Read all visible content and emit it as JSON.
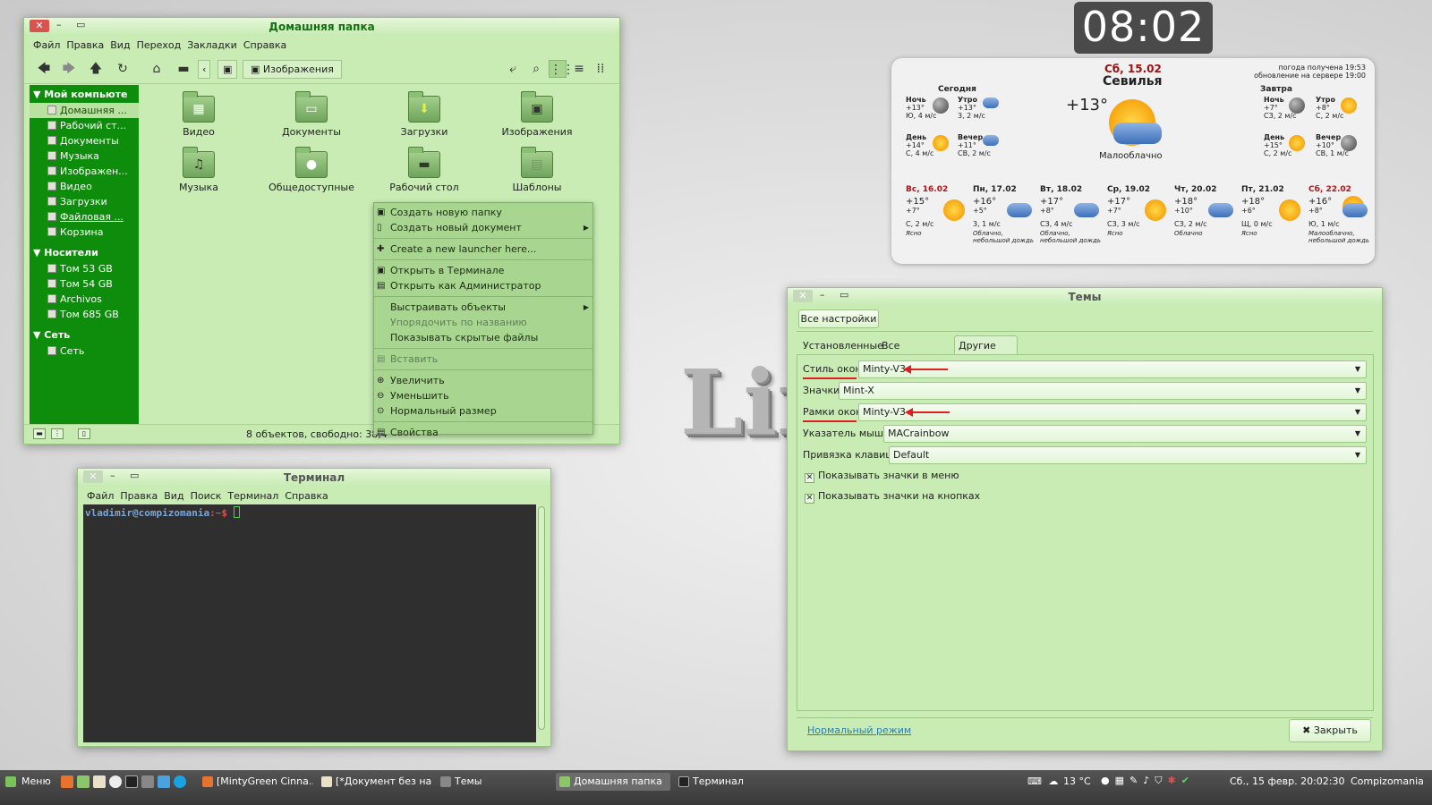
{
  "file_manager": {
    "title": "Домашняя папка",
    "menu": [
      "Файл",
      "Правка",
      "Вид",
      "Переход",
      "Закладки",
      "Справка"
    ],
    "breadcrumb": "Изображения",
    "sidebar": {
      "computer_header": "Мой компьюте",
      "computer_items": [
        "Домашняя ...",
        "Рабочий ст...",
        "Документы",
        "Музыка",
        "Изображен...",
        "Видео",
        "Загрузки",
        "Файловая ...",
        "Корзина"
      ],
      "devices_header": "Носители",
      "devices_items": [
        "Том 53 GB",
        "Том 54 GB",
        "Archivos",
        "Том 685 GB"
      ],
      "network_header": "Сеть",
      "network_items": [
        "Сеть"
      ]
    },
    "folders": [
      "Видео",
      "Документы",
      "Загрузки",
      "Изображения",
      "Музыка",
      "Общедоступные",
      "Рабочий стол",
      "Шаблоны"
    ],
    "status": "8 объектов, свободно: 38,4"
  },
  "context_menu": {
    "items": [
      "Создать новую папку",
      "Создать новый документ",
      "Create a new launcher here...",
      "Открыть в Терминале",
      "Открыть как Администратор",
      "Выстраивать объекты",
      "Упорядочить по названию",
      "Показывать скрытые файлы",
      "Вставить",
      "Увеличить",
      "Уменьшить",
      "Нормальный размер",
      "Свойства"
    ]
  },
  "terminal": {
    "title": "Терминал",
    "menu": [
      "Файл",
      "Правка",
      "Вид",
      "Поиск",
      "Терминал",
      "Справка"
    ],
    "prompt_user": "vladimir@compizomania",
    "prompt_path": ":~$"
  },
  "themes": {
    "title": "Темы",
    "all_settings": "Все настройки",
    "tabs": [
      "Установленные",
      "Все доступные",
      "Другие настройки"
    ],
    "rows": [
      {
        "label": "Стиль окон",
        "value": "Minty-V3"
      },
      {
        "label": "Значки",
        "value": "Mint-X"
      },
      {
        "label": "Рамки окон",
        "value": "Minty-V3"
      },
      {
        "label": "Указатель мыши",
        "value": "MACrainbow"
      },
      {
        "label": "Привязка клавиш",
        "value": "Default"
      }
    ],
    "checkboxes": [
      "Показывать значки в меню",
      "Показывать значки на кнопках"
    ],
    "normal_mode": "Нормальный режим",
    "close": "Закрыть"
  },
  "clock": {
    "time": "08:02"
  },
  "weather": {
    "date": "Сб, 15.02",
    "city": "Севилья",
    "temp": "+13°",
    "condition": "Малооблачно",
    "info1": "погода получена 19:53",
    "info2": "обновление на сервере 19:00",
    "today_label": "Сегодня",
    "tomorrow_label": "Завтра",
    "today": [
      {
        "name": "Ночь",
        "temp": "+13°",
        "wind": "Ю, 4 м/с"
      },
      {
        "name": "Утро",
        "temp": "+13°",
        "wind": "3, 2 м/с"
      },
      {
        "name": "День",
        "temp": "+14°",
        "wind": "С, 4 м/с"
      },
      {
        "name": "Вечер",
        "temp": "+11°",
        "wind": "СВ, 2 м/с"
      }
    ],
    "tomorrow": [
      {
        "name": "Ночь",
        "temp": "+7°",
        "wind": "СЗ, 2 м/с"
      },
      {
        "name": "Утро",
        "temp": "+8°",
        "wind": "С, 2 м/с"
      },
      {
        "name": "День",
        "temp": "+15°",
        "wind": "С, 2 м/с"
      },
      {
        "name": "Вечер",
        "temp": "+10°",
        "wind": "СВ, 1 м/с"
      }
    ],
    "forecast": [
      {
        "day": "Вс, 16.02",
        "hi": "+15°",
        "lo": "+7°",
        "wind": "С, 2 м/с",
        "desc": "Ясно",
        "desc2": "",
        "color": "#b01515"
      },
      {
        "day": "Пн, 17.02",
        "hi": "+16°",
        "lo": "+5°",
        "wind": "3, 1 м/с",
        "desc": "Облачно,",
        "desc2": "небольшой дождь",
        "color": "#222222"
      },
      {
        "day": "Вт, 18.02",
        "hi": "+17°",
        "lo": "+8°",
        "wind": "СЗ, 4 м/с",
        "desc": "Облачно,",
        "desc2": "небольшой дождь",
        "color": "#222222"
      },
      {
        "day": "Ср, 19.02",
        "hi": "+17°",
        "lo": "+7°",
        "wind": "СЗ, 3 м/с",
        "desc": "Ясно",
        "desc2": "",
        "color": "#222222"
      },
      {
        "day": "Чт, 20.02",
        "hi": "+18°",
        "lo": "+10°",
        "wind": "СЗ, 2 м/с",
        "desc": "Облачно",
        "desc2": "",
        "color": "#222222"
      },
      {
        "day": "Пт, 21.02",
        "hi": "+18°",
        "lo": "+6°",
        "wind": "Щ, 0 м/с",
        "desc": "Ясно",
        "desc2": "",
        "color": "#222222"
      },
      {
        "day": "Сб, 22.02",
        "hi": "+16°",
        "lo": "+8°",
        "wind": "Ю, 1 м/с",
        "desc": "Малооблачно,",
        "desc2": "небольшой дождь",
        "color": "#b01515"
      }
    ]
  },
  "taskbar": {
    "menu": "Меню",
    "windows": [
      "[MintyGreen Cinna...",
      "[*Документ без на...",
      "Темы",
      "Домашняя папка",
      "Терминал"
    ],
    "temp": "13 °C",
    "datetime": "Сб., 15 февр. 20:02:30",
    "hostname": "Compizomania"
  }
}
